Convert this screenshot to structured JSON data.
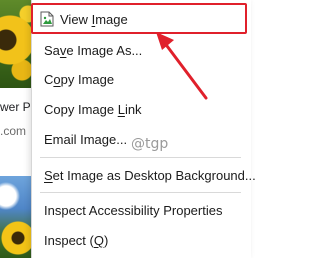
{
  "background_page": {
    "title_fragment": "wer Pi",
    "domain_fragment": ".com"
  },
  "context_menu": {
    "items": [
      {
        "pre": "View ",
        "acc": "I",
        "post": "mage"
      },
      {
        "pre": "Sa",
        "acc": "v",
        "post": "e Image As..."
      },
      {
        "pre": "C",
        "acc": "o",
        "post": "py Image"
      },
      {
        "pre": "Copy Image ",
        "acc": "L",
        "post": "ink"
      },
      {
        "pre": "Email Image...",
        "acc": "",
        "post": ""
      },
      {
        "pre": "",
        "acc": "S",
        "post": "et Image as Desktop Background..."
      },
      {
        "pre": "Inspect Accessibility Properties",
        "acc": "",
        "post": ""
      },
      {
        "pre": "Inspect (",
        "acc": "Q",
        "post": ")"
      }
    ]
  },
  "annotations": {
    "watermark": "@tgp",
    "highlight_color": "#e0202b"
  }
}
